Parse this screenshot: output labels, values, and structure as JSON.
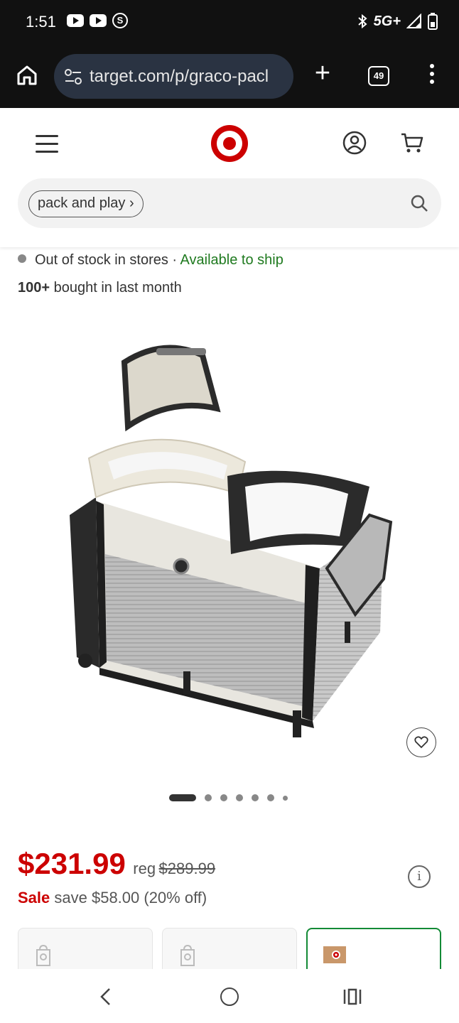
{
  "status_bar": {
    "time": "1:51",
    "network": "5G+",
    "icons": [
      "youtube-icon",
      "youtube-icon",
      "s-app-icon",
      "bluetooth-icon",
      "signal-icon",
      "battery-icon"
    ]
  },
  "browser": {
    "url": "target.com/p/graco-pacl",
    "tab_count": "49"
  },
  "header": {
    "search_chip": "pack and play",
    "icons": [
      "hamburger-icon",
      "target-logo",
      "account-icon",
      "cart-icon",
      "search-icon"
    ]
  },
  "product": {
    "stock_status": "Out of stock in stores",
    "separator": "·",
    "ship_status": "Available to ship",
    "bought_count": "100+",
    "bought_text": "bought in last month",
    "image_count": 7,
    "active_image_index": 0,
    "price": "$231.99",
    "reg_label": "reg",
    "reg_price": "$289.99",
    "sale_label": "Sale",
    "sale_text": "save $58.00 (20% off)"
  },
  "colors": {
    "brand_red": "#cc0000",
    "ship_green": "#1f7a1f",
    "selected_border": "#138a36"
  }
}
